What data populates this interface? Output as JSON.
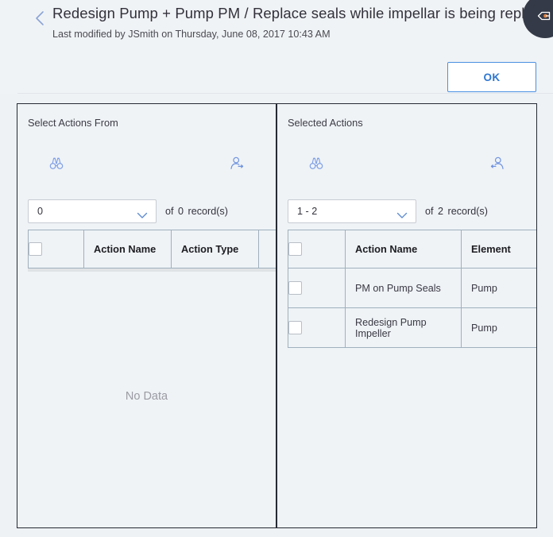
{
  "header": {
    "back_icon": "chevron-left-icon",
    "title": "Redesign Pump + Pump PM / Replace seals while impellar is being replaced",
    "subtitle": "Last modified by JSmith on Thursday, June 08, 2017 10:43 AM",
    "ok_label": "OK",
    "flyout_icon": "eye-arrow-icon",
    "accent_color": "#2f77d0",
    "flyout_bg": "#343a47"
  },
  "left_panel": {
    "title": "Select Actions From",
    "search_icon": "binoculars-icon",
    "transfer_icon": "person-arrow-right-icon",
    "pager": {
      "selected_range": "0",
      "of_label": "of",
      "count": "0",
      "records_label": "record(s)"
    },
    "table": {
      "columns": [
        "Action Name",
        "Action Type",
        ""
      ],
      "rows": [],
      "empty_message": "No Data"
    }
  },
  "right_panel": {
    "title": "Selected Actions",
    "search_icon": "binoculars-icon",
    "transfer_icon": "person-arrow-left-icon",
    "pager": {
      "selected_range": "1 - 2",
      "of_label": "of",
      "count": "2",
      "records_label": "record(s)"
    },
    "table": {
      "columns": [
        "Action Name",
        "Element"
      ],
      "rows": [
        {
          "action_name": "PM on Pump Seals",
          "element": "Pump"
        },
        {
          "action_name": "Redesign Pump Impeller",
          "element": "Pump"
        }
      ]
    }
  }
}
